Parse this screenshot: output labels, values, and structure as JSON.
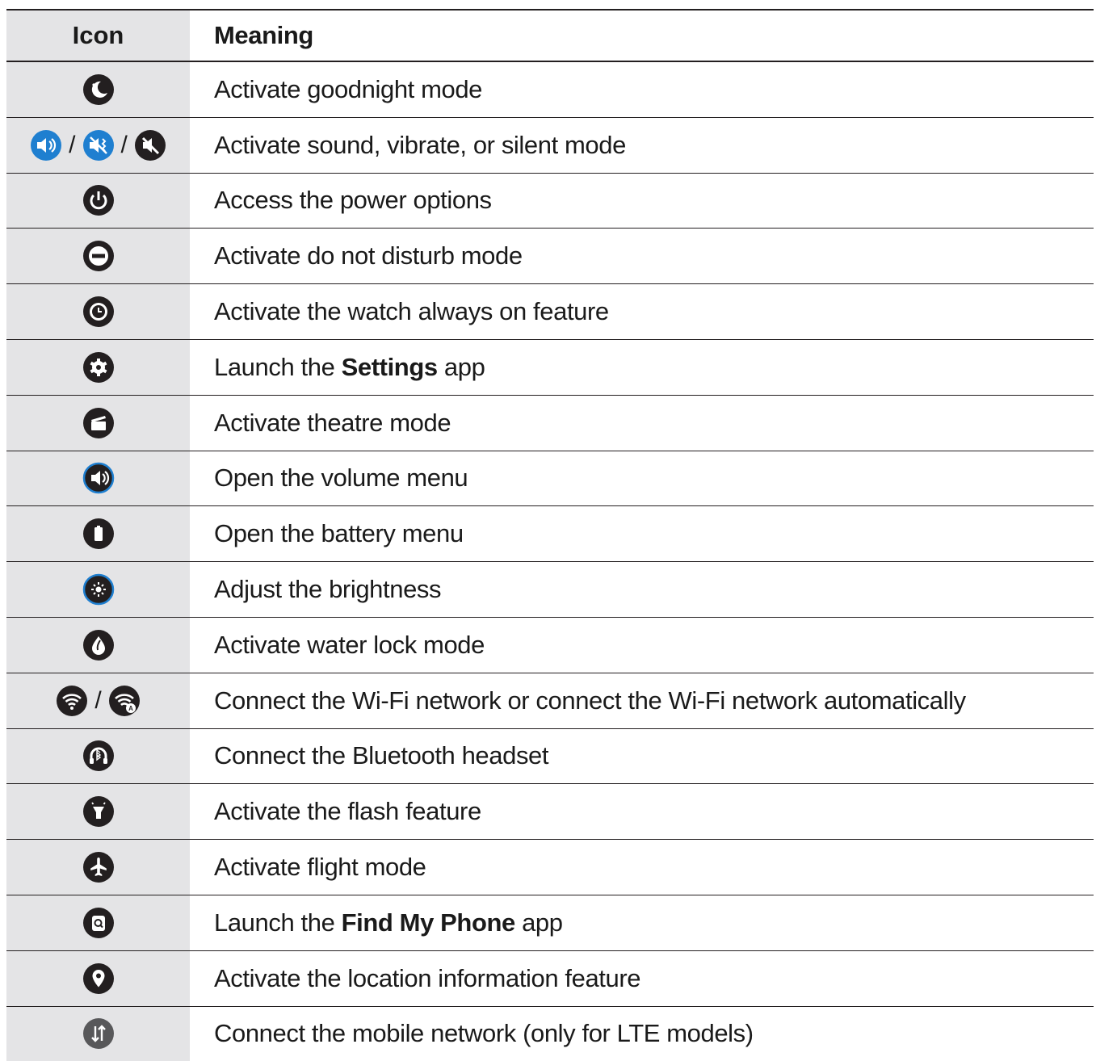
{
  "header": {
    "icon": "Icon",
    "meaning": "Meaning"
  },
  "separator": "/",
  "rows": [
    {
      "icons": [
        "moon-icon"
      ],
      "text": "Activate goodnight mode"
    },
    {
      "icons": [
        "sound-icon",
        "vibrate-icon",
        "mute-icon"
      ],
      "text": "Activate sound, vibrate, or silent mode"
    },
    {
      "icons": [
        "power-icon"
      ],
      "text": "Access the power options"
    },
    {
      "icons": [
        "do-not-disturb-icon"
      ],
      "text": "Activate do not disturb mode"
    },
    {
      "icons": [
        "watch-icon"
      ],
      "text": "Activate the watch always on feature"
    },
    {
      "icons": [
        "gear-icon"
      ],
      "pre": "Launch the ",
      "bold": "Settings",
      "post": " app"
    },
    {
      "icons": [
        "theatre-icon"
      ],
      "text": "Activate theatre mode"
    },
    {
      "icons": [
        "volume-icon"
      ],
      "text": "Open the volume menu"
    },
    {
      "icons": [
        "battery-icon"
      ],
      "text": "Open the battery menu"
    },
    {
      "icons": [
        "brightness-icon"
      ],
      "text": "Adjust the brightness"
    },
    {
      "icons": [
        "water-drop-icon"
      ],
      "text": "Activate water lock mode"
    },
    {
      "icons": [
        "wifi-icon",
        "wifi-auto-icon"
      ],
      "text": "Connect the Wi-Fi network or connect the Wi-Fi network automatically"
    },
    {
      "icons": [
        "bluetooth-headset-icon"
      ],
      "text": "Connect the Bluetooth headset"
    },
    {
      "icons": [
        "flashlight-icon"
      ],
      "text": "Activate the flash feature"
    },
    {
      "icons": [
        "airplane-icon"
      ],
      "text": "Activate flight mode"
    },
    {
      "icons": [
        "find-phone-icon"
      ],
      "pre": "Launch the ",
      "bold": "Find My Phone",
      "post": " app"
    },
    {
      "icons": [
        "location-icon"
      ],
      "text": "Activate the location information feature"
    },
    {
      "icons": [
        "mobile-data-icon"
      ],
      "text": "Connect the mobile network (only for LTE models)"
    }
  ],
  "colors": {
    "icon_dark": "#231f20",
    "icon_blue": "#1f7fd0",
    "icon_gray": "#58585a",
    "icon_column_bg": "#e4e4e6"
  }
}
